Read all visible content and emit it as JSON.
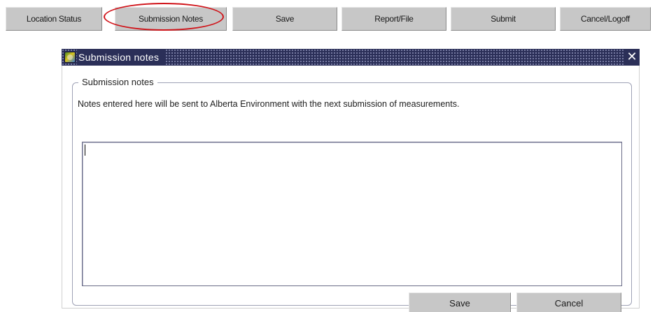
{
  "toolbar": {
    "buttons": [
      {
        "label": "Location Status"
      },
      {
        "label": "Submission Notes"
      },
      {
        "label": "Save"
      },
      {
        "label": "Report/File"
      },
      {
        "label": "Submit"
      },
      {
        "label": "Cancel/Logoff"
      }
    ],
    "highlighted_button": "Submission Notes"
  },
  "dialog": {
    "title": "Submission notes",
    "group_label": "Submission notes",
    "instructions": "Notes entered here will be sent to Alberta Environment with the next submission of measurements.",
    "notes_value": "",
    "save_label": "Save",
    "cancel_label": "Cancel"
  },
  "colors": {
    "titlebar": "#2b2f58",
    "button_face": "#c7c7c7",
    "highlight_annotation": "#d0141a"
  }
}
